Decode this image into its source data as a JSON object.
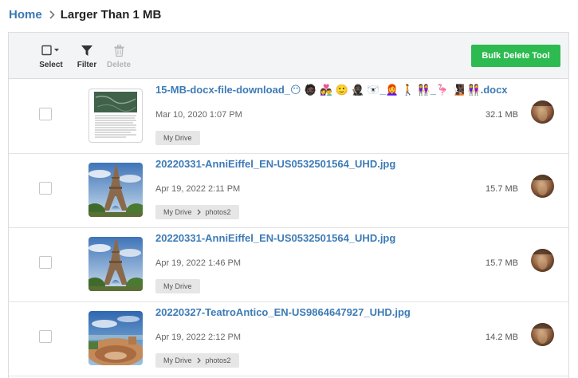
{
  "breadcrumb": {
    "home": "Home",
    "current": "Larger Than 1 MB"
  },
  "toolbar": {
    "select_label": "Select",
    "filter_label": "Filter",
    "delete_label": "Delete",
    "bulk_delete_label": "Bulk Delete Tool"
  },
  "colors": {
    "accent": "#3d7bb6",
    "bulk_button": "#2dbb51"
  },
  "files": [
    {
      "name": "15-MB-docx-file-download_😶 🧔🏿 👩‍❤️‍👨 🙂 🥷🏿 🐻‍❄️_👩‍🦰 🚶 👭_🦩 🧏🏿 👭.docx",
      "date": "Mar 10, 2020 1:07 PM",
      "size": "32.1 MB",
      "path": [
        "My Drive"
      ],
      "thumbnail": "document-thumbnail"
    },
    {
      "name": "20220331-AnniEiffel_EN-US0532501564_UHD.jpg",
      "date": "Apr 19, 2022 2:11 PM",
      "size": "15.7 MB",
      "path": [
        "My Drive",
        "photos2"
      ],
      "thumbnail": "eiffel-tower-thumbnail"
    },
    {
      "name": "20220331-AnniEiffel_EN-US0532501564_UHD.jpg",
      "date": "Apr 19, 2022 1:46 PM",
      "size": "15.7 MB",
      "path": [
        "My Drive"
      ],
      "thumbnail": "eiffel-tower-thumbnail"
    },
    {
      "name": "20220327-TeatroAntico_EN-US9864647927_UHD.jpg",
      "date": "Apr 19, 2022 2:12 PM",
      "size": "14.2 MB",
      "path": [
        "My Drive",
        "photos2"
      ],
      "thumbnail": "theatre-thumbnail"
    }
  ]
}
